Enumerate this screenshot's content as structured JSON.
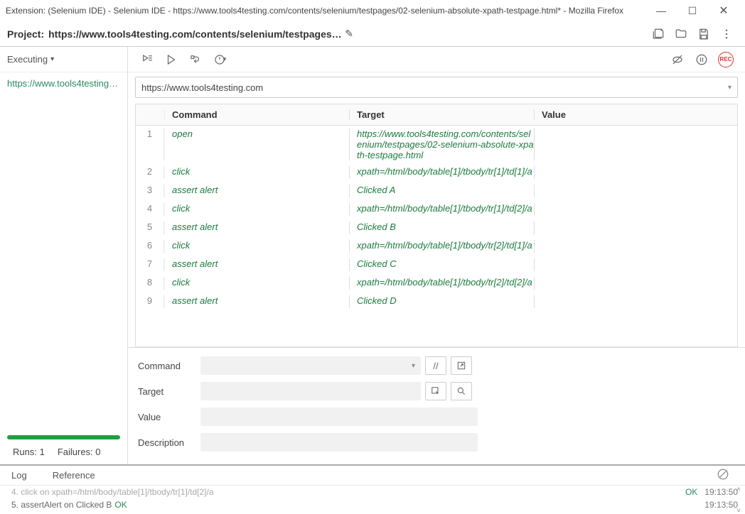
{
  "window": {
    "title": "Extension: (Selenium IDE) - Selenium IDE - https://www.tools4testing.com/contents/selenium/testpages/02-selenium-absolute-xpath-testpage.html* - Mozilla Firefox"
  },
  "project": {
    "label": "Project:",
    "url": "https://www.tools4testing.com/contents/selenium/testpages/02-selenium-absolute-xpath-testpage.html*"
  },
  "left": {
    "status": "Executing",
    "test_item": "https://www.tools4testing.c...",
    "runs_label": "Runs: 1",
    "failures_label": "Failures: 0"
  },
  "urlbar": {
    "value": "https://www.tools4testing.com"
  },
  "grid": {
    "headers": {
      "command": "Command",
      "target": "Target",
      "value": "Value"
    },
    "rows": [
      {
        "idx": "1",
        "command": "open",
        "target": "https://www.tools4testing.com/contents/selenium/testpages/02-selenium-absolute-xpath-testpage.html",
        "value": ""
      },
      {
        "idx": "2",
        "command": "click",
        "target": "xpath=/html/body/table[1]/tbody/tr[1]/td[1]/a",
        "value": ""
      },
      {
        "idx": "3",
        "command": "assert alert",
        "target": "Clicked A",
        "value": ""
      },
      {
        "idx": "4",
        "command": "click",
        "target": "xpath=/html/body/table[1]/tbody/tr[1]/td[2]/a",
        "value": ""
      },
      {
        "idx": "5",
        "command": "assert alert",
        "target": "Clicked B",
        "value": ""
      },
      {
        "idx": "6",
        "command": "click",
        "target": "xpath=/html/body/table[1]/tbody/tr[2]/td[1]/a",
        "value": ""
      },
      {
        "idx": "7",
        "command": "assert alert",
        "target": "Clicked C",
        "value": ""
      },
      {
        "idx": "8",
        "command": "click",
        "target": "xpath=/html/body/table[1]/tbody/tr[2]/td[2]/a",
        "value": ""
      },
      {
        "idx": "9",
        "command": "assert alert",
        "target": "Clicked D",
        "value": ""
      }
    ]
  },
  "form": {
    "command": "Command",
    "target": "Target",
    "value": "Value",
    "description": "Description"
  },
  "tabs": {
    "log": "Log",
    "reference": "Reference"
  },
  "log": {
    "line4_num": "4.",
    "line4_text": "click on xpath=/html/body/table[1]/tbody/tr[1]/td[2]/a",
    "line4_ok": "OK",
    "line4_ts": "19:13:50",
    "line5_num": "5.",
    "line5_text": "assertAlert on Clicked B",
    "line5_ok": "OK",
    "line5_ts": "19:13:50"
  },
  "record_label": "REC"
}
